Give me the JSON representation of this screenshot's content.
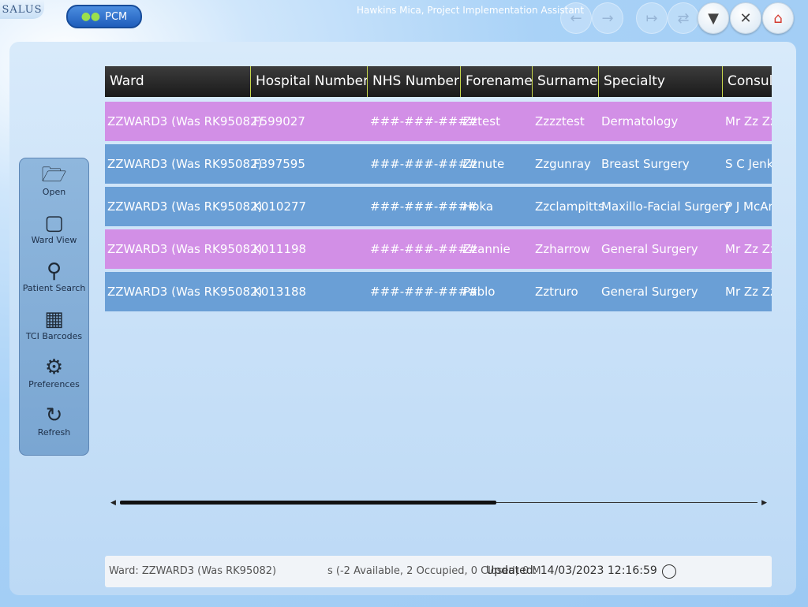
{
  "app": {
    "logo": "SALUS",
    "pcm_label": "PCM",
    "user": "Hawkins Mica, Project Implementation Assistant"
  },
  "sidebar": {
    "items": [
      {
        "label": "Open"
      },
      {
        "label": "Ward View"
      },
      {
        "label": "Patient Search"
      },
      {
        "label": "TCI Barcodes"
      },
      {
        "label": "Preferences"
      },
      {
        "label": "Refresh"
      }
    ]
  },
  "table": {
    "columns": [
      "Ward",
      "Hospital Number",
      "NHS Number",
      "Forename",
      "Surname",
      "Specialty",
      "Consultant"
    ],
    "rows": [
      {
        "style": "pink",
        "cells": [
          "ZZWARD3 (Was RK95082)",
          "F599027",
          "###-###-####",
          "Zztest",
          "Zzzztest",
          "Dermatology",
          "Mr Zz Zz"
        ]
      },
      {
        "style": "blue",
        "cells": [
          "ZZWARD3 (Was RK95082)",
          "F397595",
          "###-###-####",
          "Zznute",
          "Zzgunray",
          "Breast Surgery",
          "S C Jenk"
        ]
      },
      {
        "style": "blue",
        "cells": [
          "ZZWARD3 (Was RK95082)",
          "K010277",
          "###-###-####",
          "Hoka",
          "Zzclampitts",
          "Maxillo-Facial Surgery",
          "P J McAr"
        ]
      },
      {
        "style": "pink",
        "cells": [
          "ZZWARD3 (Was RK95082)",
          "K011198",
          "###-###-####",
          "Zzannie",
          "Zzharrow",
          "General Surgery",
          "Mr Zz Zz"
        ]
      },
      {
        "style": "blue",
        "cells": [
          "ZZWARD3 (Was RK95082)",
          "K013188",
          "###-###-####",
          "Pablo",
          "Zztruro",
          "General Surgery",
          "Mr Zz Zz"
        ]
      }
    ]
  },
  "status": {
    "ward": "Ward: ZZWARD3 (Was RK95082)",
    "beds": "s (-2 Available, 2 Occupied, 0 Closed) 0 M",
    "updated": "Updated: 14/03/2023 12:16:59"
  },
  "scroll": {
    "thumb_fraction": 0.59
  }
}
